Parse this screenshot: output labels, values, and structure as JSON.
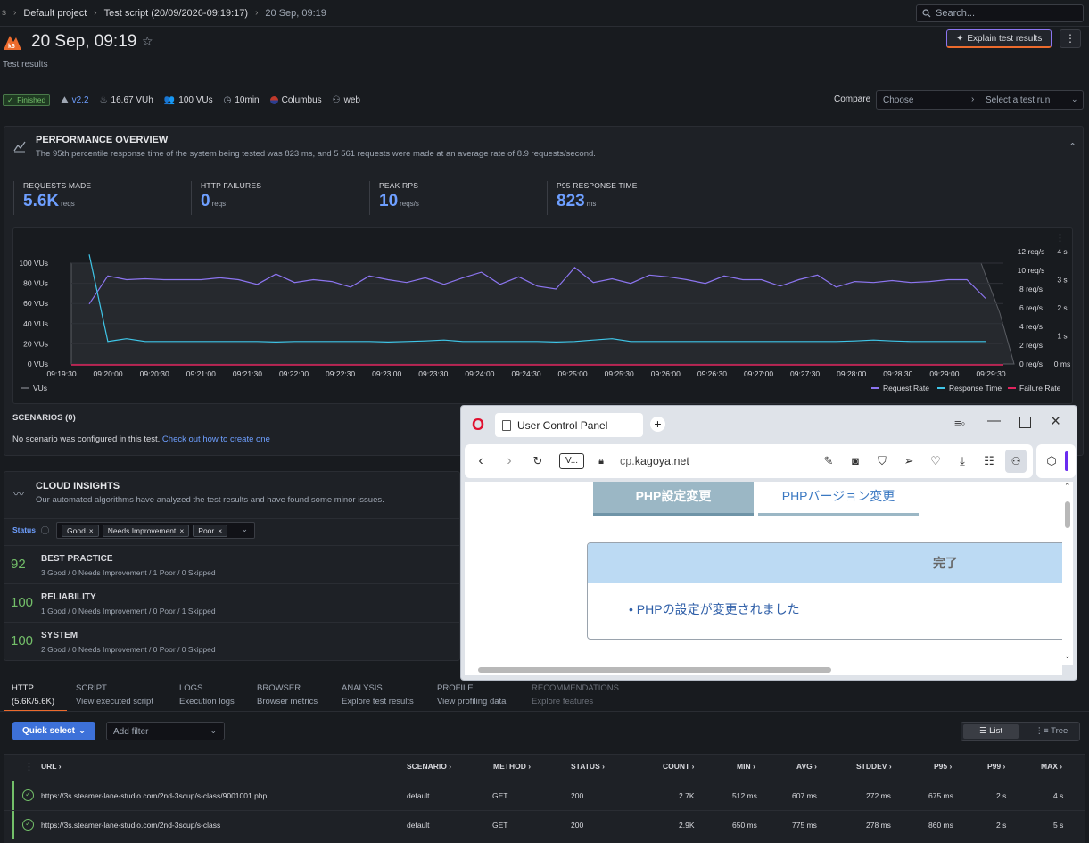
{
  "breadcrumb": {
    "project": "Default project",
    "script": "Test script (20/09/2026-09:19:17)",
    "run": "20 Sep, 09:19"
  },
  "search": {
    "placeholder": "Search..."
  },
  "header": {
    "title": "20 Sep, 09:19",
    "subtitle": "Test results",
    "explain_button": "Explain test results"
  },
  "meta": {
    "status": "Finished",
    "version": "v2.2",
    "vuh": "16.67 VUh",
    "vus": "100 VUs",
    "duration": "10min",
    "location": "Columbus",
    "origin": "web",
    "compare_label": "Compare",
    "compare_choose": "Choose",
    "compare_select": "Select a test run"
  },
  "performance": {
    "title": "PERFORMANCE OVERVIEW",
    "description": "The 95th percentile response time of the system being tested was 823 ms, and 5 561 requests were made at an average rate of 8.9 requests/second.",
    "stats": [
      {
        "label": "REQUESTS MADE",
        "value": "5.6K",
        "unit": "reqs"
      },
      {
        "label": "HTTP FAILURES",
        "value": "0",
        "unit": "reqs"
      },
      {
        "label": "PEAK RPS",
        "value": "10",
        "unit": "reqs/s"
      },
      {
        "label": "P95 RESPONSE TIME",
        "value": "823",
        "unit": "ms"
      }
    ]
  },
  "chart_data": {
    "type": "line",
    "x": [
      "09:19:30",
      "09:20:00",
      "09:20:30",
      "09:21:00",
      "09:21:30",
      "09:22:00",
      "09:22:30",
      "09:23:00",
      "09:23:30",
      "09:24:00",
      "09:24:30",
      "09:25:00",
      "09:25:30",
      "09:26:00",
      "09:26:30",
      "09:27:00",
      "09:27:30",
      "09:28:00",
      "09:28:30",
      "09:29:00",
      "09:29:30"
    ],
    "y_vus_ticks": [
      "100 VUs",
      "80 VUs",
      "60 VUs",
      "40 VUs",
      "20 VUs",
      "0 VUs"
    ],
    "y_rps_ticks": [
      "12 req/s",
      "10 req/s",
      "8 req/s",
      "6 req/s",
      "4 req/s",
      "2 req/s",
      "0 req/s"
    ],
    "y_time_ticks": [
      "4 s",
      "3 s",
      "2 s",
      "1 s",
      "0 ms"
    ],
    "legend": [
      "VUs",
      "Request Rate",
      "Response Time",
      "Failure Rate"
    ],
    "series": [
      {
        "name": "Request Rate",
        "color": "#8c75f0",
        "values": [
          6.4,
          9.4,
          9.0,
          9.1,
          9.0,
          9.0,
          9.0,
          9.2,
          9.0,
          8.5,
          9.6,
          8.7,
          9.0,
          8.8,
          8.2,
          9.4,
          9.0,
          8.7,
          9.2,
          8.5,
          9.2,
          9.8,
          8.5,
          9.3,
          8.3,
          8.0,
          10.3,
          8.7,
          9.1,
          8.6,
          9.5,
          9.3,
          9.0,
          8.6,
          9.4,
          9.0,
          9.0,
          8.3,
          9.0,
          9.5,
          8.2,
          8.8,
          8.7,
          8.9,
          8.7,
          8.8,
          9.0,
          9.0,
          7.0
        ]
      },
      {
        "name": "Response Time",
        "color": "#3fc6e8",
        "values": [
          3.9,
          0.8,
          0.9,
          0.8,
          0.8,
          0.8,
          0.8,
          0.8,
          0.8,
          0.8,
          0.78,
          0.8,
          0.8,
          0.8,
          0.8,
          0.8,
          0.78,
          0.8,
          0.82,
          0.85,
          0.8,
          0.8,
          0.8,
          0.8,
          0.8,
          0.78,
          0.8,
          0.85,
          0.9,
          0.8,
          0.8,
          0.8,
          0.8,
          0.8,
          0.8,
          0.8,
          0.8,
          0.8,
          0.8,
          0.8,
          0.8,
          0.82,
          0.85,
          0.82,
          0.8,
          0.8,
          0.8,
          0.8,
          0.8
        ]
      },
      {
        "name": "Failure Rate",
        "color": "#e0245e",
        "values": [
          0
        ]
      },
      {
        "name": "VUs",
        "color": "#5a5d63",
        "values": [
          100,
          100,
          100,
          0
        ]
      }
    ]
  },
  "scenarios": {
    "title": "SCENARIOS (0)",
    "text": "No scenario was configured in this test.",
    "link": "Check out how to create one"
  },
  "insights": {
    "title": "CLOUD INSIGHTS",
    "description": "Our automated algorithms have analyzed the test results and have found some minor issues.",
    "status_label": "Status",
    "chips": [
      "Good",
      "Needs Improvement",
      "Poor"
    ],
    "rows": [
      {
        "score": "92",
        "title": "BEST PRACTICE",
        "sub": "3 Good / 0 Needs Improvement / 1 Poor / 0 Skipped"
      },
      {
        "score": "100",
        "title": "RELIABILITY",
        "sub": "1 Good / 0 Needs Improvement / 0 Poor / 1 Skipped"
      },
      {
        "score": "100",
        "title": "SYSTEM",
        "sub": "2 Good / 0 Needs Improvement / 0 Poor / 0 Skipped"
      }
    ]
  },
  "tabs": [
    {
      "t1": "HTTP",
      "t2": "(5.6K/5.6K)"
    },
    {
      "t1": "SCRIPT",
      "t2": "View executed script"
    },
    {
      "t1": "LOGS",
      "t2": "Execution logs"
    },
    {
      "t1": "BROWSER",
      "t2": "Browser metrics"
    },
    {
      "t1": "ANALYSIS",
      "t2": "Explore test results"
    },
    {
      "t1": "PROFILE",
      "t2": "View profiling data"
    },
    {
      "t1": "RECOMMENDATIONS",
      "t2": "Explore features"
    }
  ],
  "filters": {
    "quick_select": "Quick select",
    "add_filter": "Add filter",
    "list": "List",
    "tree": "Tree"
  },
  "table": {
    "headers": [
      "URL",
      "SCENARIO",
      "METHOD",
      "STATUS",
      "COUNT",
      "MIN",
      "AVG",
      "STDDEV",
      "P95",
      "P99",
      "MAX"
    ],
    "rows": [
      [
        "https://3s.steamer-lane-studio.com/2nd-3scup/s-class/9001001.php",
        "default",
        "GET",
        "200",
        "2.7K",
        "512 ms",
        "607 ms",
        "272 ms",
        "675 ms",
        "2 s",
        "4 s"
      ],
      [
        "https://3s.steamer-lane-studio.com/2nd-3scup/s-class",
        "default",
        "GET",
        "200",
        "2.9K",
        "650 ms",
        "775 ms",
        "278 ms",
        "860 ms",
        "2 s",
        "5 s"
      ]
    ]
  },
  "browser": {
    "tab_title": "User Control Panel",
    "vpn": "V...",
    "url_prefix": "cp.",
    "url_domain": "kagoya.net",
    "page_tab_active": "PHP設定変更",
    "page_tab_inactive": "PHPバージョン変更",
    "box_title": "完了",
    "box_item": "PHPの設定が変更されました"
  }
}
